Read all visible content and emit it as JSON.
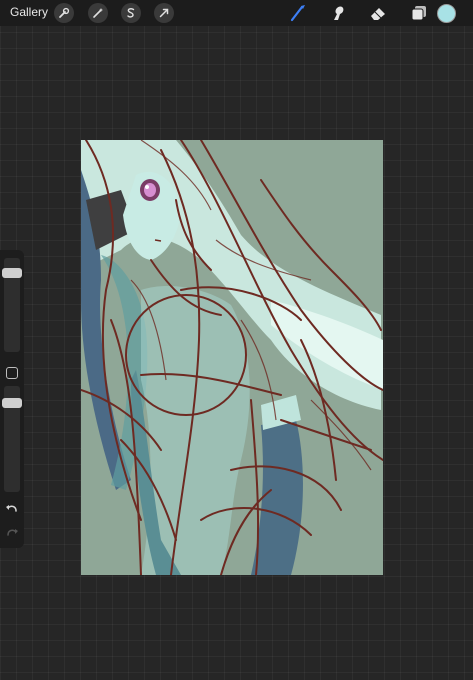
{
  "app": {
    "gallery_label": "Gallery"
  },
  "toolbar_left": [
    "wrench-icon",
    "magic-wand-icon",
    "selection-icon",
    "transform-icon"
  ],
  "toolbar_right": [
    "brush-icon",
    "smudge-icon",
    "eraser-icon",
    "layers-icon"
  ],
  "active_tool": "brush",
  "colors": {
    "topbar": "#1c1c1c",
    "background": "#262626",
    "canvas_background": "#8fa797",
    "active_tool": "#3d7ff5",
    "current_color": "#a8e2e6",
    "sketch_lines": "#6e2a22",
    "hair_light": "#cfeee6",
    "hair_dark": "#4b6a86"
  },
  "sidebar": {
    "brush_size_level": 0.12,
    "opacity_level": 0.12
  }
}
